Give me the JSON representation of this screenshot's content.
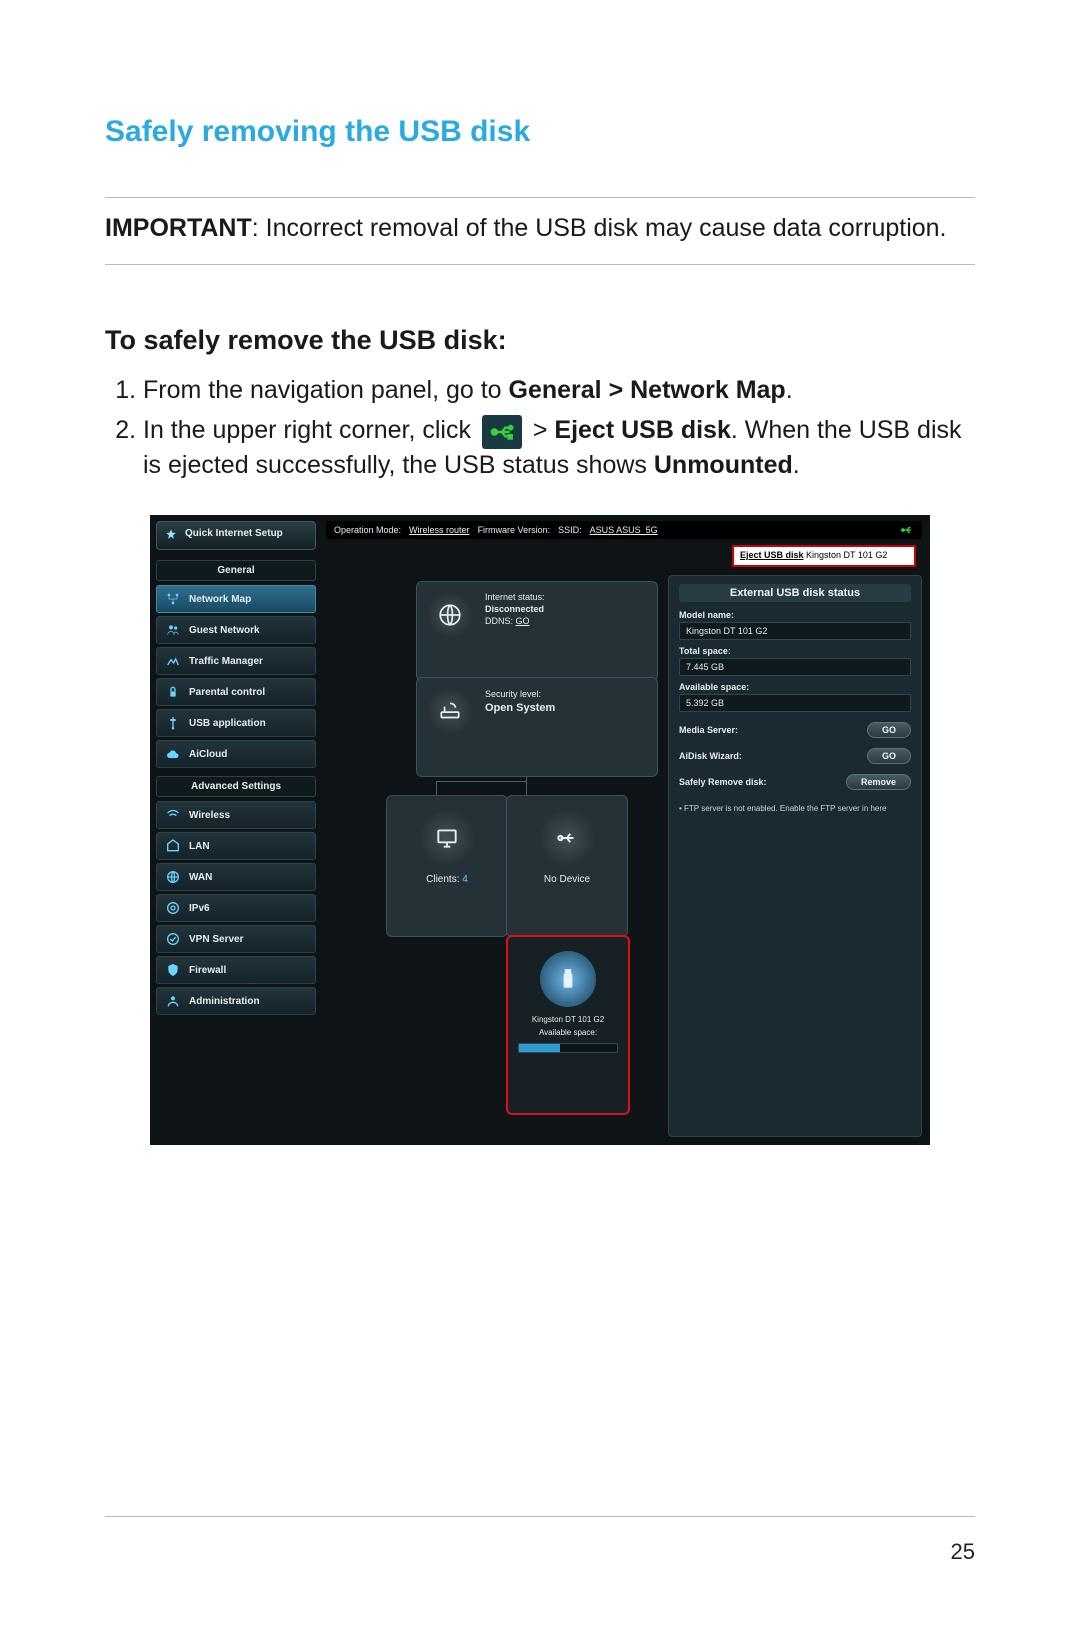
{
  "doc": {
    "section_title": "Safely removing the USB disk",
    "important_label": "IMPORTANT",
    "important_text": ":  Incorrect removal of the USB disk may cause data corruption.",
    "sub_title": "To safely remove the USB disk:",
    "step1_a": "From the navigation panel, go to ",
    "step1_b": "General > Network Map",
    "step1_c": ".",
    "step2_a": "In the upper right corner, click ",
    "step2_b": " > ",
    "step2_c": "Eject USB disk",
    "step2_d": ". When the USB disk is ejected successfully, the USB status shows ",
    "step2_e": "Unmounted",
    "step2_f": ".",
    "page_number": "25"
  },
  "ui": {
    "qis": "Quick Internet Setup",
    "side_general": "General",
    "side_adv": "Advanced Settings",
    "nav_general": [
      "Network Map",
      "Guest Network",
      "Traffic Manager",
      "Parental control",
      "USB application",
      "AiCloud"
    ],
    "nav_adv": [
      "Wireless",
      "LAN",
      "WAN",
      "IPv6",
      "VPN Server",
      "Firewall",
      "Administration"
    ],
    "top": {
      "op_label": "Operation Mode:",
      "op_value": "Wireless router",
      "fw_label": "Firmware Version:",
      "ssid_label": "SSID:",
      "ssid_value": "ASUS  ASUS_5G"
    },
    "eject": {
      "pre": "Eject USB disk",
      "dev": " Kingston DT 101 G2"
    },
    "globe": {
      "l1": "Internet status:",
      "l2": "Disconnected",
      "l3": "DDNS:",
      "go": "GO"
    },
    "router": {
      "l1": "Security level:",
      "l2": "Open System"
    },
    "clients": {
      "label": "Clients:",
      "count": "4"
    },
    "nodev": "No Device",
    "usbdev": {
      "name": "Kingston DT 101 G2",
      "avail": "Available space:"
    },
    "panel": {
      "title": "External USB disk status",
      "model_l": "Model name:",
      "model_v": "Kingston DT 101 G2",
      "total_l": "Total space:",
      "total_v": "7.445 GB",
      "avail_l": "Available space:",
      "avail_v": "5.392 GB",
      "media_l": "Media Server:",
      "go": "GO",
      "aidisk_l": "AiDisk Wizard:",
      "safe_l": "Safely Remove disk:",
      "remove": "Remove",
      "note": "•   FTP server is not enabled. Enable the FTP server in here"
    }
  }
}
